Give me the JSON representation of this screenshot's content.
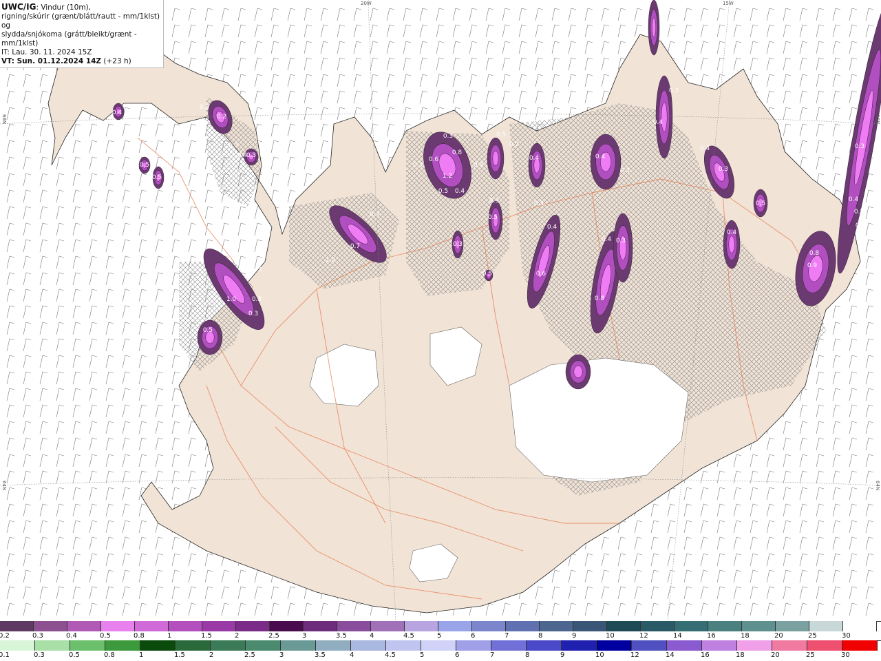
{
  "header": {
    "model": "UWC/IG",
    "line1": ": Vindur (10m),",
    "line2": "rigning/skúrir (grænt/blátt/rautt - mm/1klst) og",
    "line3": "slydda/snjókoma (grátt/bleikt/grænt - mm/1klst)",
    "it": "IT: Lau. 30. 11. 2024 15Z",
    "vt": "VT: Sun. 01.12.2024 14Z",
    "vt_offset": " (+23 h)"
  },
  "graticule": {
    "lon_20w": "20W",
    "lon_15w": "15W",
    "lat_66n_left": "66N",
    "lat_66n_right": "66N",
    "lat_64n_left": "64N",
    "lat_64n_right": "64N"
  },
  "colors": {
    "land": "#f1e3d6",
    "road": "#e77a4e",
    "ice": "#ffffff",
    "sea": "#ffffff",
    "barb": "#7a7a7a",
    "snow_dark": "#6a3a70",
    "snow_mid": "#b24fc0",
    "snow_light": "#f07cf5"
  },
  "snow_legend": {
    "labels": [
      "0.2",
      "0.3",
      "0.4",
      "0.5",
      "0.8",
      "1",
      "1.5",
      "2",
      "2.5",
      "3",
      "3.5",
      "4",
      "4.5",
      "5",
      "6",
      "7",
      "8",
      "9",
      "10",
      "12",
      "14",
      "16",
      "18",
      "20",
      "25",
      "30"
    ],
    "colors": [
      "#5e3a62",
      "#8c4f90",
      "#b05ab6",
      "#e880ee",
      "#d06ad8",
      "#b44fbe",
      "#9a3aa6",
      "#7a2c88",
      "#4a0a4e",
      "#6d2d7c",
      "#8a4c9c",
      "#a070b8",
      "#b8a4e0",
      "#9aa4e8",
      "#7c86cc",
      "#6070b0",
      "#4c6690",
      "#3a5676",
      "#1e4a56",
      "#2a5a66",
      "#346e74",
      "#4a8080",
      "#5e9090",
      "#7aa0a0",
      "#c8d8d8",
      "#ffffff"
    ]
  },
  "rain_legend": {
    "labels": [
      "0.1",
      "0.3",
      "0.5",
      "0.8",
      "1",
      "1.5",
      "2",
      "2.5",
      "3",
      "3.5",
      "4",
      "4.5",
      "5",
      "6",
      "7",
      "8",
      "9",
      "10",
      "12",
      "14",
      "16",
      "18",
      "20",
      "25",
      "30"
    ],
    "colors": [
      "#d8f5d8",
      "#a8e0a8",
      "#6cc06c",
      "#3c9a3c",
      "#0a4a0a",
      "#2a6a3a",
      "#3a7a56",
      "#4a8a6e",
      "#6a9a96",
      "#90aec0",
      "#a8b8e0",
      "#c0c4f0",
      "#d0d2f8",
      "#a0a0e8",
      "#7070d8",
      "#4a4ac8",
      "#2020b0",
      "#0000a0",
      "#5050c0",
      "#8a5ad0",
      "#c080e0",
      "#f0a0e8",
      "#f07aa0",
      "#f05070",
      "#f00000"
    ]
  },
  "precip_labels": [
    "0.4",
    "0.3",
    "0.2",
    "0.3",
    "0.3",
    "0.3",
    "0.5",
    "0.5",
    "0.4",
    "1.3",
    "1.0",
    "0.3",
    "0.3",
    "0.5",
    "0.9",
    "0.7",
    "1.2",
    "0.3",
    "0.3",
    "0.6",
    "0.8",
    "0.4",
    "1.2",
    "0.5",
    "0.4",
    "0.5",
    "0.7",
    "0.4",
    "0.3",
    "0.5",
    "0.3",
    "0.5",
    "0.6",
    "0.3",
    "0.4",
    "0.4",
    "0.3",
    "0.4",
    "0.3",
    "0.4",
    "0.3",
    "0.8",
    "0.4",
    "0.2",
    "0.0",
    "0.3",
    "0.4",
    "0.5",
    "0.4",
    "0.5",
    "0.6",
    "0.3",
    "0.9",
    "0.8"
  ]
}
